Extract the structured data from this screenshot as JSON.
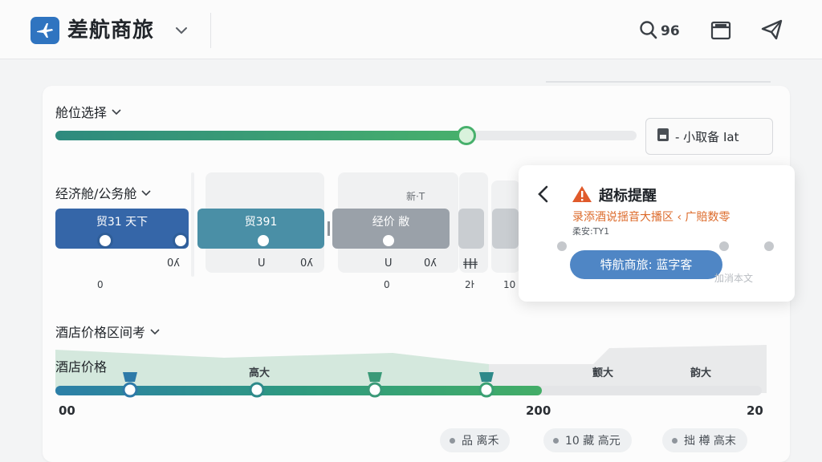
{
  "header": {
    "app_title": "差航商旅",
    "search_count": "96",
    "icons": {
      "logo": "airplane-icon",
      "search": "search-icon",
      "calendar": "calendar-icon",
      "send": "send-icon"
    }
  },
  "cabin": {
    "section_title": "舱位选择",
    "side_button_label": "- 小取备 Iat",
    "slider_value_fraction": 0.7
  },
  "economy": {
    "section_title": "经济舱/公务舱",
    "ghost_header": "新·T",
    "chips": [
      {
        "label": "贸31 天下",
        "color": "#3566a8"
      },
      {
        "label": "贸391",
        "color": "#4a8fa6"
      },
      {
        "label": "经价 敝",
        "color": "#9aa1a9"
      }
    ],
    "under_labels": [
      "0ʎ",
      "U",
      "0ʎ",
      "U",
      "0ʎ",
      "ǂǂǂ"
    ],
    "tick_labels": [
      "0",
      "0",
      "2ŀ",
      "10"
    ]
  },
  "popup": {
    "title": "超标提醒",
    "message": "录添酒说揺音大播区 ‹   广賠数零",
    "sub": "柔安:TY1",
    "button_label": "特航商旅: 蓝字客",
    "ghost_text": "加消本文"
  },
  "hotel": {
    "section_title": "酒店价格区间考",
    "chart_label": "酒店价格",
    "pin_labels": [
      "高大",
      "颤大",
      "韵大"
    ],
    "axis_labels": [
      "00",
      "200",
      "20"
    ],
    "slider_value_fraction": 0.69
  },
  "pills": [
    {
      "label": "品 离禾"
    },
    {
      "label": "10 藏 高元"
    },
    {
      "label": "拙 樽 高末"
    }
  ],
  "colors": {
    "accent_blue": "#2f74c0",
    "accent_green": "#47b06c",
    "warning": "#e05a2b"
  }
}
